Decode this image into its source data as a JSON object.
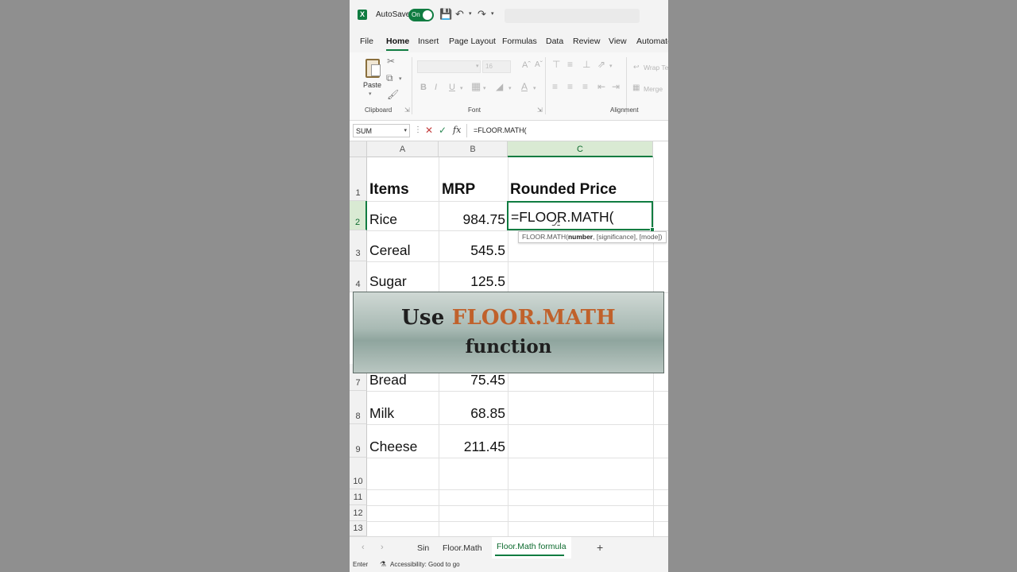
{
  "titlebar": {
    "app_icon": "X",
    "autosave_label": "AutoSave",
    "autosave_state": "On",
    "icons": [
      "save-icon",
      "undo-icon",
      "redo-icon",
      "customize-icon"
    ]
  },
  "tabs": [
    {
      "label": "File"
    },
    {
      "label": "Home",
      "active": true
    },
    {
      "label": "Insert"
    },
    {
      "label": "Page Layout"
    },
    {
      "label": "Formulas"
    },
    {
      "label": "Data"
    },
    {
      "label": "Review"
    },
    {
      "label": "View"
    },
    {
      "label": "Automate"
    }
  ],
  "ribbon": {
    "clipboard": {
      "label": "Clipboard",
      "paste_label": "Paste"
    },
    "font": {
      "label": "Font",
      "size": "16",
      "bold": "B",
      "italic": "I",
      "underline": "U",
      "font_color_glyph": "A"
    },
    "alignment": {
      "label": "Alignment",
      "wrap_text": "Wrap Te",
      "merge": "Merge"
    }
  },
  "formula_bar": {
    "name_box": "SUM",
    "fx_label": "fx",
    "formula": "=FLOOR.MATH("
  },
  "columns": [
    "A",
    "B",
    "C"
  ],
  "rows": [
    "1",
    "2",
    "3",
    "4",
    "7",
    "8",
    "9",
    "10",
    "11",
    "12",
    "13"
  ],
  "cells": {
    "header": {
      "items": "Items",
      "mrp": "MRP",
      "rounded": "Rounded Price"
    },
    "data": [
      {
        "item": "Rice",
        "mrp": "984.75"
      },
      {
        "item": "Cereal",
        "mrp": "545.5"
      },
      {
        "item": "Sugar",
        "mrp": "125.5"
      },
      {
        "item": "Bread",
        "mrp": "75.45"
      },
      {
        "item": "Milk",
        "mrp": "68.85"
      },
      {
        "item": "Cheese",
        "mrp": "211.45"
      }
    ],
    "active_entry": "=FLOOR.MATH("
  },
  "tooltip": {
    "func": "FLOOR.MATH(",
    "arg_bold": "number",
    "rest": ", [significance], [mode])"
  },
  "banner": {
    "prefix": "Use ",
    "highlight": "FLOOR.MATH",
    "line2": "function",
    "highlight_color": "#c0612b"
  },
  "sheets": [
    {
      "label": "Sin"
    },
    {
      "label": "Floor.Math"
    },
    {
      "label": "Floor.Math formula",
      "active": true
    }
  ],
  "add_sheet": "+",
  "status": {
    "mode": "Enter",
    "accessibility": "Accessibility: Good to go"
  },
  "colors": {
    "excel_green": "#107c41",
    "grid_line": "#e1e1e1"
  }
}
